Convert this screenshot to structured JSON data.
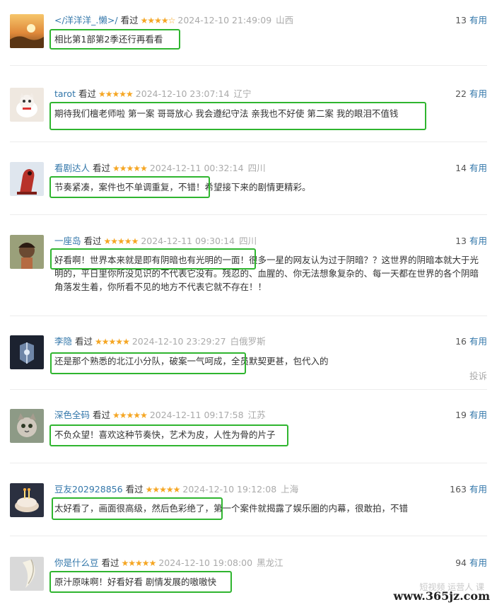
{
  "reviews": [
    {
      "username": "</洋洋洋_.懒>/",
      "watched": "看过",
      "stars": "★★★★☆",
      "time": "2024-12-10 21:49:09",
      "location": "山西",
      "count": "13",
      "useful": "有用",
      "content": "相比第1部第2季还行再看看"
    },
    {
      "username": "tarot",
      "watched": "看过",
      "stars": "★★★★★",
      "time": "2024-12-10 23:07:14",
      "location": "辽宁",
      "count": "22",
      "useful": "有用",
      "content": "期待我们檀老师啦 第一案 哥哥放心 我会遵纪守法 亲我也不好使 第二案 我的眼泪不值钱"
    },
    {
      "username": "看剧达人",
      "watched": "看过",
      "stars": "★★★★★",
      "time": "2024-12-11 00:32:14",
      "location": "四川",
      "count": "14",
      "useful": "有用",
      "content": "节奏紧凑，案件也不单调重复，不错！希望接下来的剧情更精彩。"
    },
    {
      "username": "一座岛",
      "watched": "看过",
      "stars": "★★★★★",
      "time": "2024-12-11 09:30:14",
      "location": "四川",
      "count": "13",
      "useful": "有用",
      "content": "好看啊！世界本来就是即有阴暗也有光明的一面！很多一星的网友认为过于阴暗？？这世界的阴暗本就大于光明的，平日里你所没见识的不代表它没有。残忍的、血腥的、你无法想象复杂的、每一天都在世界的各个阴暗角落发生着，你所看不见的地方不代表它就不存在！！"
    },
    {
      "username": "李隐",
      "watched": "看过",
      "stars": "★★★★★",
      "time": "2024-12-10 23:29:27",
      "location": "白俄罗斯",
      "count": "16",
      "useful": "有用",
      "content": "还是那个熟悉的北江小分队，破案一气呵成，全员默契更甚，包代入的",
      "report": "投诉"
    },
    {
      "username": "深色全码",
      "watched": "看过",
      "stars": "★★★★★",
      "time": "2024-12-11 09:17:58",
      "location": "江苏",
      "count": "19",
      "useful": "有用",
      "content": "不负众望！喜欢这种节奏快，艺术为皮，人性为骨的片子"
    },
    {
      "username": "豆友202928856",
      "watched": "看过",
      "stars": "★★★★★",
      "time": "2024-12-10 19:12:08",
      "location": "上海",
      "count": "163",
      "useful": "有用",
      "content": "太好看了，画面很高级，然后色彩绝了，第一个案件就揭露了娱乐圈的内幕，很敢拍，不错"
    },
    {
      "username": "你是什么豆",
      "watched": "看过",
      "stars": "★★★★★",
      "time": "2024-12-10 19:08:00",
      "location": "黑龙江",
      "count": "94",
      "useful": "有用",
      "content": "原汁原味啊！好看好看 剧情发展的嗷嗷快"
    }
  ],
  "watermark": "www.365jz.com",
  "watermark_faint": "短视频 运营人 课"
}
